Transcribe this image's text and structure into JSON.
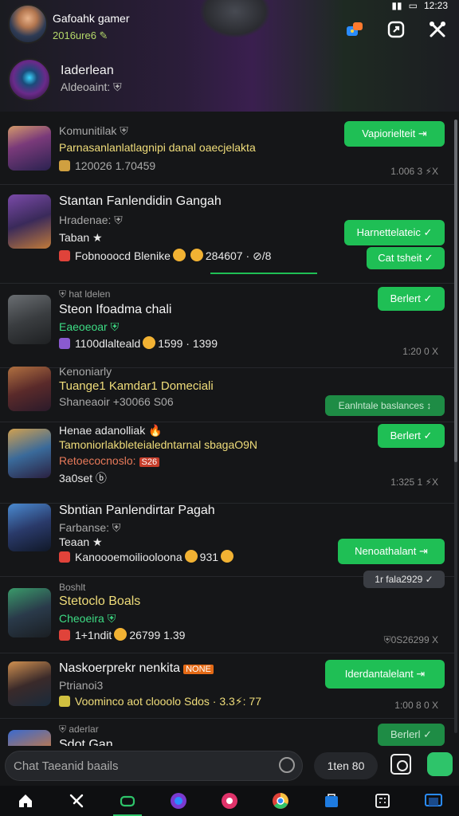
{
  "status_bar": {
    "signal": "",
    "time": "12:23"
  },
  "header": {
    "user_name": "Gafoahk gamer",
    "user_status": "2016ure6 ✎",
    "group_name": "Iaderlean",
    "group_sub": "Aldeoaint: ⛨",
    "icons": [
      "colorful-app-icon",
      "share-box-icon",
      "tools-icon"
    ]
  },
  "rows": [
    {
      "line1": "Komunitilak ⛨",
      "line2": "Parnasanlanlatlagnipi danal oaecjelakta",
      "line3": "120026 1.70459",
      "pill": "Vapiorielteit ⇥",
      "meta": "1.006 3 ⚡X"
    },
    {
      "line1": "Stantan Fanlendidin Gangah",
      "line2": "Hradenae: ⛨",
      "line3": "Taban ★",
      "line4": "Fobnooocd Blenike",
      "line4b": "284607 · ⊘/8",
      "pill": "Harnettelateic ✓",
      "pill2": "Cat tsheit ✓"
    },
    {
      "line0": "⛨ hat ldelen",
      "line1": "Steon Ifoadma chali",
      "line2": "Eaeoeoar ⛨",
      "line3": "1100dlalteald",
      "line3b": "1599 · 1399",
      "pill": "Berlert ✓",
      "meta": "1:20 0 X"
    },
    {
      "line1": "Kenoniarly",
      "line2": "Tuange1 Kamdar1 Domeciali",
      "line3": "Shaneaoir +30066 S06",
      "pill": "Eanlntale baslances ↕"
    },
    {
      "line1": "Henae adanolliak 🔥",
      "line2": "Tamoniorlakbleteialedntarnal sbagaO9N",
      "line3": "Retoecocnoslo:",
      "badge": "S26",
      "line4": "3a0set ⓑ",
      "pill": "Berlert ✓",
      "meta": "1:325 1 ⚡X"
    },
    {
      "line1": "Sbntian Panlendirtar Pagah",
      "line2": "Farbanse: ⛨",
      "line3": "Teaan ★",
      "line4": "Kanoooemoiliooloona",
      "line4b": "931",
      "pill": "Nenoathalant ⇥",
      "pill2": "1r fala2929 ✓"
    },
    {
      "line0": "Boshlt",
      "line1": "Stetoclo Boals",
      "line2": "Cheoeira ⛨",
      "line3": "1+1ndit",
      "line3b": "26799 1.39",
      "meta": "⛨0S26299 X"
    },
    {
      "line1": "Naskoerprekr nenkita",
      "badge": "NONE",
      "line2": "Ptrianoi3",
      "line3": "Voominco aot clooolo Sdos · 3.3⚡: 77",
      "pill": "Iderdantalelant ⇥",
      "meta": "1:00 8 0 X"
    },
    {
      "line0": "⛨ aderlar",
      "line1": "Sdot Gan",
      "pill": "Berlerl ✓"
    }
  ],
  "composer": {
    "placeholder": "Chat Taeanid baails",
    "count": "1ten 80"
  },
  "nav": [
    "home-icon",
    "tools-icon",
    "game-icon",
    "app-icon",
    "music-icon",
    "chrome-icon",
    "store-icon",
    "calculator-icon",
    "window-icon"
  ]
}
